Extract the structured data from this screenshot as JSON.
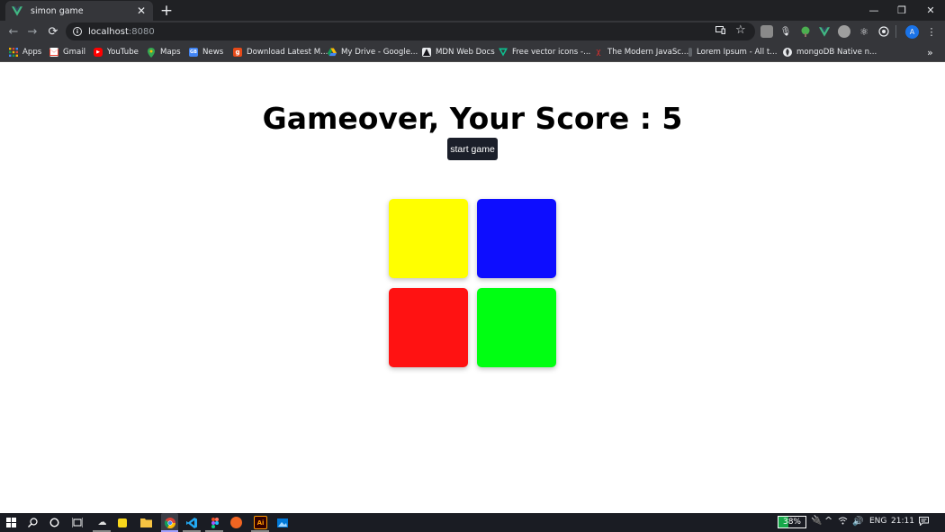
{
  "browser": {
    "tab": {
      "title": "simon game",
      "favicon": "vue-logo-icon",
      "close_label": "✕"
    },
    "new_tab_label": "+",
    "window_controls": {
      "minimize": "—",
      "restore": "❐",
      "close": "✕"
    },
    "nav": {
      "back": "←",
      "forward": "→",
      "reload": "⟳"
    },
    "address": {
      "host": "localhost",
      "port": ":8080"
    },
    "profile_initial": "A",
    "bookmarks": [
      {
        "label": "Apps",
        "icon": "apps-grid-icon"
      },
      {
        "label": "Gmail",
        "icon": "gmail-icon"
      },
      {
        "label": "YouTube",
        "icon": "youtube-icon"
      },
      {
        "label": "Maps",
        "icon": "maps-icon"
      },
      {
        "label": "News",
        "icon": "news-icon"
      },
      {
        "label": "Download Latest M...",
        "icon": "download-site-icon"
      },
      {
        "label": "My Drive - Google...",
        "icon": "google-drive-icon"
      },
      {
        "label": "MDN Web Docs",
        "icon": "mdn-icon"
      },
      {
        "label": "Free vector icons -...",
        "icon": "vector-icons-icon"
      },
      {
        "label": "The Modern JavaSc...",
        "icon": "javascript-info-icon"
      },
      {
        "label": "Lorem Ipsum - All t...",
        "icon": "lorem-ipsum-icon"
      },
      {
        "label": "mongoDB Native n...",
        "icon": "mongodb-icon"
      }
    ],
    "overflow_label": "»"
  },
  "game": {
    "heading": "Gameover, Your Score : 5",
    "start_button": "start game",
    "pads": [
      {
        "name": "yellow-pad",
        "color": "#ffff00"
      },
      {
        "name": "blue-pad",
        "color": "#0d0dff"
      },
      {
        "name": "red-pad",
        "color": "#ff1212"
      },
      {
        "name": "green-pad",
        "color": "#00ff12"
      }
    ]
  },
  "taskbar": {
    "battery": "38%",
    "battery_level": 0.38,
    "language": "ENG",
    "time": "21:11"
  },
  "colors": {
    "tab_bar": "#202124",
    "toolbar": "#35363a",
    "button_dark": "#1b1f2a",
    "taskbar": "#1a1c23"
  }
}
